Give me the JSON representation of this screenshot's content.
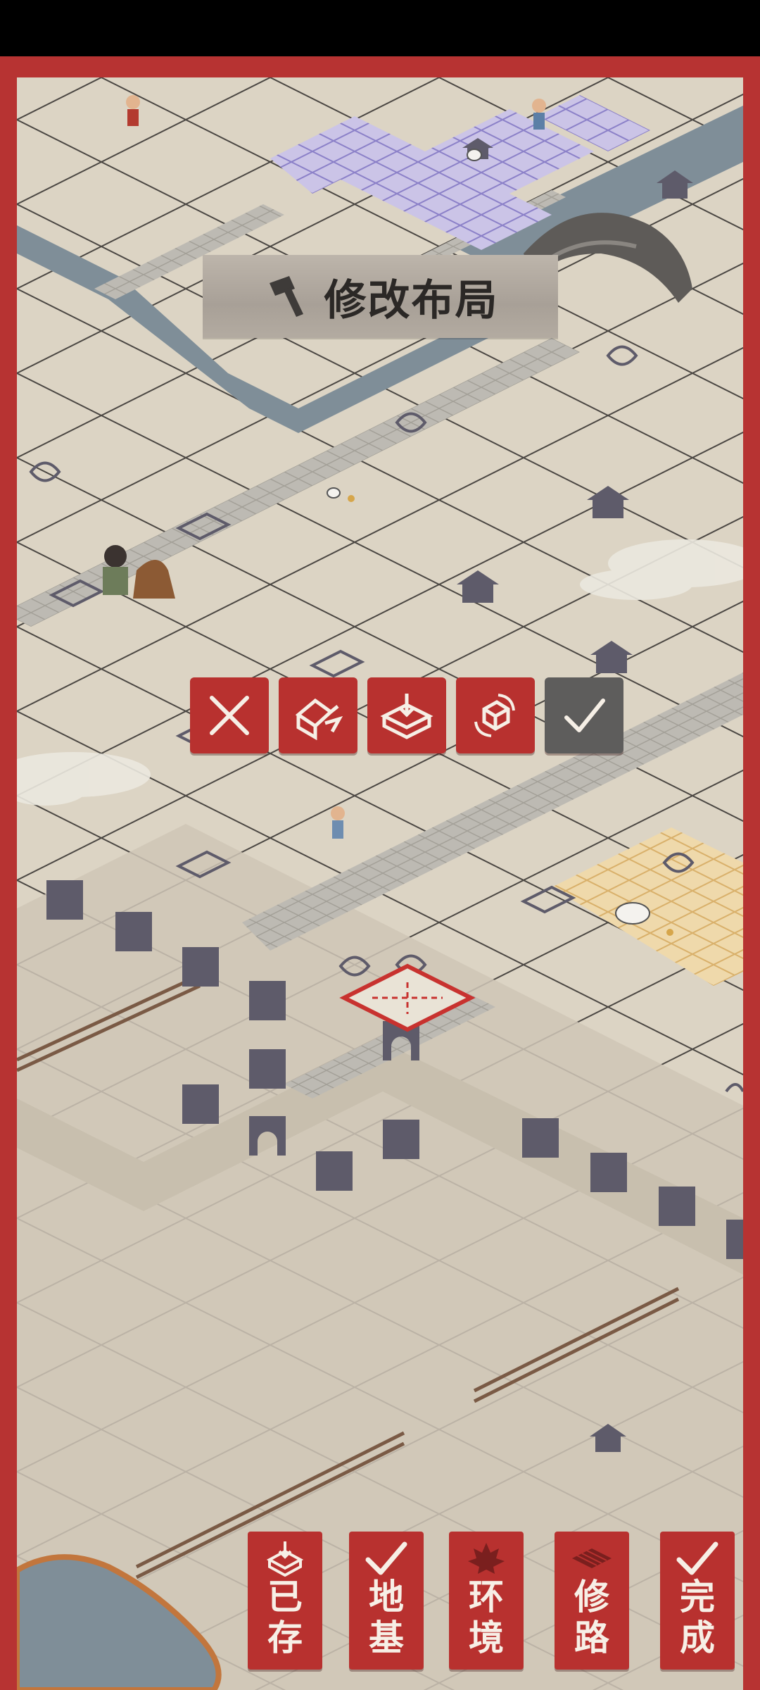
{
  "banner": {
    "title": "修改布局",
    "icon": "hammer-icon"
  },
  "action_bar": [
    {
      "id": "cancel",
      "icon": "close-icon"
    },
    {
      "id": "demolish",
      "icon": "demolish-icon"
    },
    {
      "id": "store",
      "icon": "store-box-icon"
    },
    {
      "id": "rotate",
      "icon": "rotate-icon"
    },
    {
      "id": "confirm",
      "icon": "check-icon"
    }
  ],
  "bottom_bar": [
    {
      "id": "saved",
      "label_top": "已",
      "label_bottom": "存",
      "icon": "box-down-icon"
    },
    {
      "id": "foundation",
      "label_top": "地",
      "label_bottom": "基",
      "icon": "check-icon"
    },
    {
      "id": "environment",
      "label_top": "环",
      "label_bottom": "境",
      "icon": "maple-leaf-icon"
    },
    {
      "id": "road",
      "label_top": "修",
      "label_bottom": "路",
      "icon": "paving-icon"
    },
    {
      "id": "done",
      "label_top": "完",
      "label_bottom": "成",
      "icon": "check-icon"
    }
  ],
  "colors": {
    "frame": "#b73332",
    "button_red": "#b8312f",
    "button_gray": "#5e5d5c",
    "ground": "#d9d1c1",
    "water": "#7f8e98",
    "purple_tile": "#c9c2e6",
    "orange_tile": "#f0d8a8"
  }
}
